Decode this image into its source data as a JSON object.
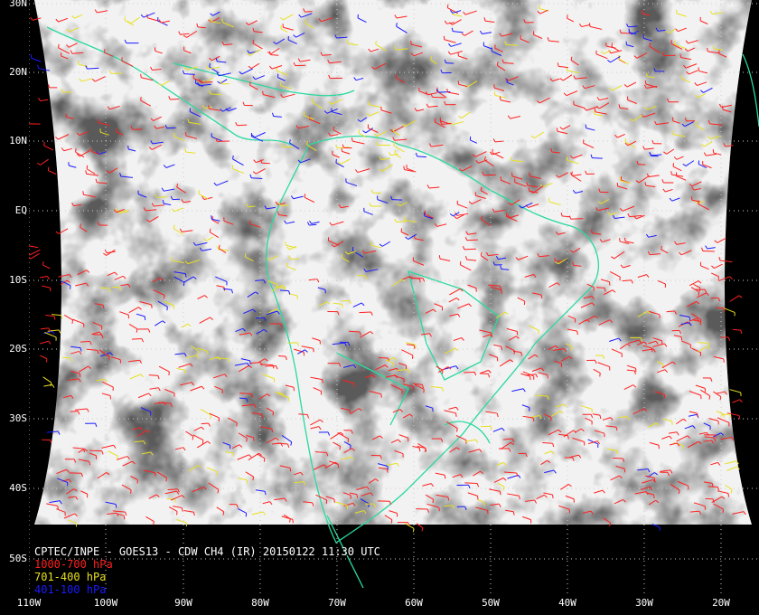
{
  "title": "CPTEC/INPE - GOES13 - CDW CH4 (IR) 20150122 11:30 UTC",
  "legend": [
    {
      "label": "1000-700 hPa",
      "color": "#ff2020"
    },
    {
      "label": "701-400 hPa",
      "color": "#e8e020"
    },
    {
      "label": "401-100 hPa",
      "color": "#1a1aff"
    }
  ],
  "lat_labels": [
    "30N",
    "20N",
    "10N",
    "EQ",
    "10S",
    "20S",
    "30S",
    "40S",
    "50S"
  ],
  "lon_labels": [
    "110W",
    "100W",
    "90W",
    "80W",
    "70W",
    "60W",
    "50W",
    "40W",
    "30W",
    "20W"
  ],
  "colors": {
    "coastline": "#2ad9a0",
    "grid": "#cccccc",
    "background": "#000000"
  }
}
